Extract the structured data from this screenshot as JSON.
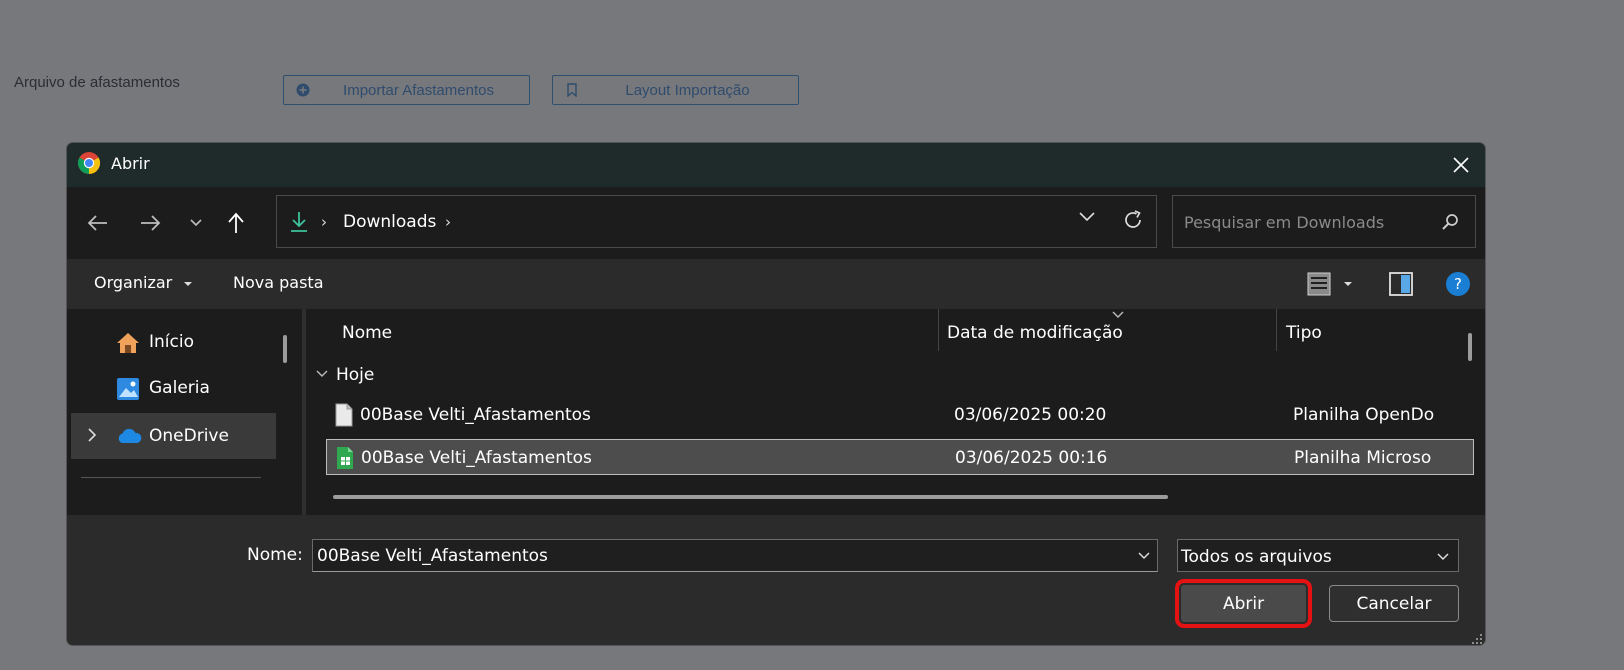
{
  "background_page": {
    "field_label": "Arquivo de afastamentos",
    "import_button": "Importar Afastamentos",
    "layout_button": "Layout Importação"
  },
  "dialog": {
    "title": "Abrir",
    "address": {
      "location": "Downloads"
    },
    "search": {
      "placeholder": "Pesquisar em Downloads"
    },
    "toolbar": {
      "organize": "Organizar",
      "new_folder": "Nova pasta"
    },
    "nav_pane": {
      "items": [
        {
          "label": "Início",
          "icon": "home-icon"
        },
        {
          "label": "Galeria",
          "icon": "gallery-icon"
        },
        {
          "label": "OneDrive",
          "icon": "onedrive-icon",
          "selected": true
        }
      ]
    },
    "file_list": {
      "columns": [
        "Nome",
        "Data de modificação",
        "Tipo"
      ],
      "group": "Hoje",
      "rows": [
        {
          "name": "00Base Velti_Afastamentos",
          "date": "03/06/2025 00:20",
          "type": "Planilha OpenDo",
          "icon": "ods-file-icon"
        },
        {
          "name": "00Base Velti_Afastamentos",
          "date": "03/06/2025 00:16",
          "type": "Planilha Microso",
          "icon": "xlsx-file-icon",
          "selected": true
        }
      ]
    },
    "footer": {
      "name_label": "Nome:",
      "name_value": "00Base Velti_Afastamentos",
      "file_type": "Todos os arquivos",
      "open_button": "Abrir",
      "cancel_button": "Cancelar"
    }
  },
  "colors": {
    "page_background": "#77787c",
    "dialog_background": "#202020",
    "highlight_outline": "#e41212",
    "help_blue": "#1a7fd4"
  }
}
